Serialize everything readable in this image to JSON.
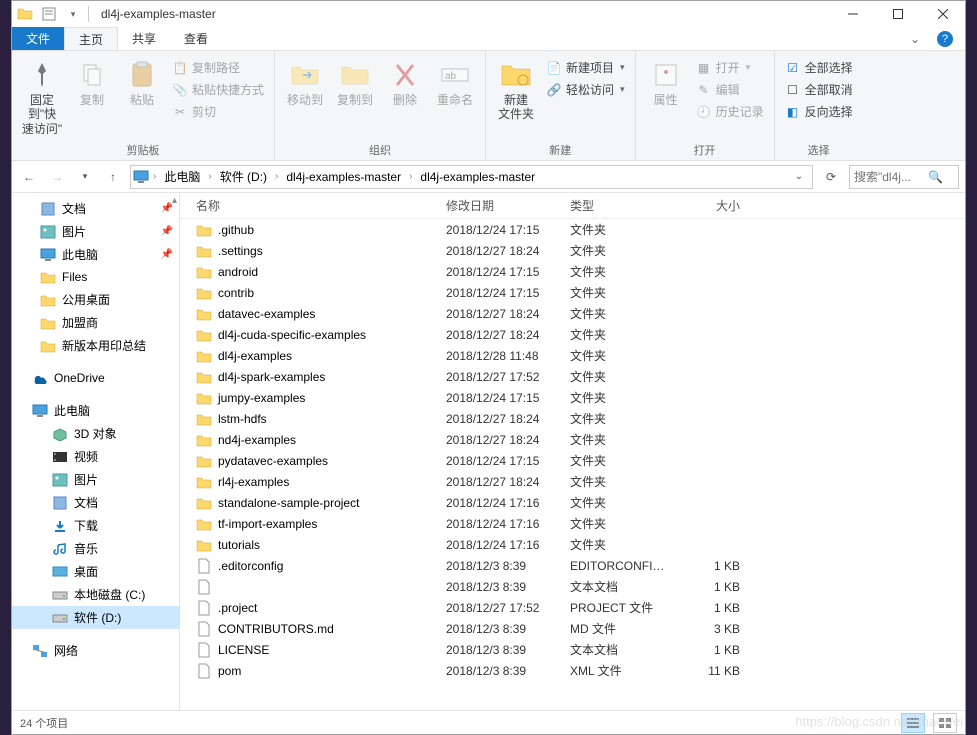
{
  "title": "dl4j-examples-master",
  "tabs": {
    "file": "文件",
    "home": "主页",
    "share": "共享",
    "view": "查看"
  },
  "ribbon": {
    "clipboard": {
      "label": "剪贴板",
      "pin": "固定到\"快\n速访问\"",
      "copy": "复制",
      "paste": "粘贴",
      "copypath": "复制路径",
      "pasteshortcut": "粘贴快捷方式",
      "cut": "剪切"
    },
    "organize": {
      "label": "组织",
      "moveto": "移动到",
      "copyto": "复制到",
      "delete": "删除",
      "rename": "重命名"
    },
    "new": {
      "label": "新建",
      "newfolder": "新建\n文件夹",
      "newitem": "新建项目",
      "easyaccess": "轻松访问"
    },
    "open": {
      "label": "打开",
      "properties": "属性",
      "open": "打开",
      "edit": "编辑",
      "history": "历史记录"
    },
    "select": {
      "label": "选择",
      "selectall": "全部选择",
      "selectnone": "全部取消",
      "invert": "反向选择"
    }
  },
  "breadcrumbs": [
    "此电脑",
    "软件 (D:)",
    "dl4j-examples-master",
    "dl4j-examples-master"
  ],
  "search_placeholder": "搜索\"dl4j...",
  "columns": {
    "name": "名称",
    "date": "修改日期",
    "type": "类型",
    "size": "大小"
  },
  "quickaccess": [
    {
      "label": "文档",
      "icon": "doc"
    },
    {
      "label": "图片",
      "icon": "pic"
    },
    {
      "label": "此电脑",
      "icon": "pc"
    },
    {
      "label": "Files",
      "icon": "folder"
    },
    {
      "label": "公用桌面",
      "icon": "folder"
    },
    {
      "label": "加盟商",
      "icon": "folder"
    },
    {
      "label": "新版本用印总结",
      "icon": "folder"
    }
  ],
  "onedrive": "OneDrive",
  "thispc": {
    "label": "此电脑",
    "items": [
      {
        "label": "3D 对象",
        "icon": "3d"
      },
      {
        "label": "视频",
        "icon": "video"
      },
      {
        "label": "图片",
        "icon": "pic"
      },
      {
        "label": "文档",
        "icon": "doc"
      },
      {
        "label": "下载",
        "icon": "dl"
      },
      {
        "label": "音乐",
        "icon": "music"
      },
      {
        "label": "桌面",
        "icon": "desktop"
      },
      {
        "label": "本地磁盘 (C:)",
        "icon": "drive"
      },
      {
        "label": "软件 (D:)",
        "icon": "drive",
        "selected": true
      }
    ]
  },
  "network": "网络",
  "files": [
    {
      "name": ".github",
      "date": "2018/12/24 17:15",
      "type": "文件夹",
      "size": "",
      "icon": "folder"
    },
    {
      "name": ".settings",
      "date": "2018/12/27 18:24",
      "type": "文件夹",
      "size": "",
      "icon": "folder"
    },
    {
      "name": "android",
      "date": "2018/12/24 17:15",
      "type": "文件夹",
      "size": "",
      "icon": "folder"
    },
    {
      "name": "contrib",
      "date": "2018/12/24 17:15",
      "type": "文件夹",
      "size": "",
      "icon": "folder"
    },
    {
      "name": "datavec-examples",
      "date": "2018/12/27 18:24",
      "type": "文件夹",
      "size": "",
      "icon": "folder"
    },
    {
      "name": "dl4j-cuda-specific-examples",
      "date": "2018/12/27 18:24",
      "type": "文件夹",
      "size": "",
      "icon": "folder"
    },
    {
      "name": "dl4j-examples",
      "date": "2018/12/28 11:48",
      "type": "文件夹",
      "size": "",
      "icon": "folder"
    },
    {
      "name": "dl4j-spark-examples",
      "date": "2018/12/27 17:52",
      "type": "文件夹",
      "size": "",
      "icon": "folder"
    },
    {
      "name": "jumpy-examples",
      "date": "2018/12/24 17:15",
      "type": "文件夹",
      "size": "",
      "icon": "folder"
    },
    {
      "name": "lstm-hdfs",
      "date": "2018/12/27 18:24",
      "type": "文件夹",
      "size": "",
      "icon": "folder"
    },
    {
      "name": "nd4j-examples",
      "date": "2018/12/27 18:24",
      "type": "文件夹",
      "size": "",
      "icon": "folder"
    },
    {
      "name": "pydatavec-examples",
      "date": "2018/12/24 17:15",
      "type": "文件夹",
      "size": "",
      "icon": "folder"
    },
    {
      "name": "rl4j-examples",
      "date": "2018/12/27 18:24",
      "type": "文件夹",
      "size": "",
      "icon": "folder"
    },
    {
      "name": "standalone-sample-project",
      "date": "2018/12/24 17:16",
      "type": "文件夹",
      "size": "",
      "icon": "folder"
    },
    {
      "name": "tf-import-examples",
      "date": "2018/12/24 17:16",
      "type": "文件夹",
      "size": "",
      "icon": "folder"
    },
    {
      "name": "tutorials",
      "date": "2018/12/24 17:16",
      "type": "文件夹",
      "size": "",
      "icon": "folder"
    },
    {
      "name": ".editorconfig",
      "date": "2018/12/3 8:39",
      "type": "EDITORCONFIG ...",
      "size": "1 KB",
      "icon": "file"
    },
    {
      "name": "",
      "date": "2018/12/3 8:39",
      "type": "文本文档",
      "size": "1 KB",
      "icon": "file"
    },
    {
      "name": ".project",
      "date": "2018/12/27 17:52",
      "type": "PROJECT 文件",
      "size": "1 KB",
      "icon": "file"
    },
    {
      "name": "CONTRIBUTORS.md",
      "date": "2018/12/3 8:39",
      "type": "MD 文件",
      "size": "3 KB",
      "icon": "file"
    },
    {
      "name": "LICENSE",
      "date": "2018/12/3 8:39",
      "type": "文本文档",
      "size": "1 KB",
      "icon": "file"
    },
    {
      "name": "pom",
      "date": "2018/12/3 8:39",
      "type": "XML 文件",
      "size": "11 KB",
      "icon": "file"
    }
  ],
  "status": "24 个项目",
  "watermark": "https://blog.csdn.net/zhaowei"
}
